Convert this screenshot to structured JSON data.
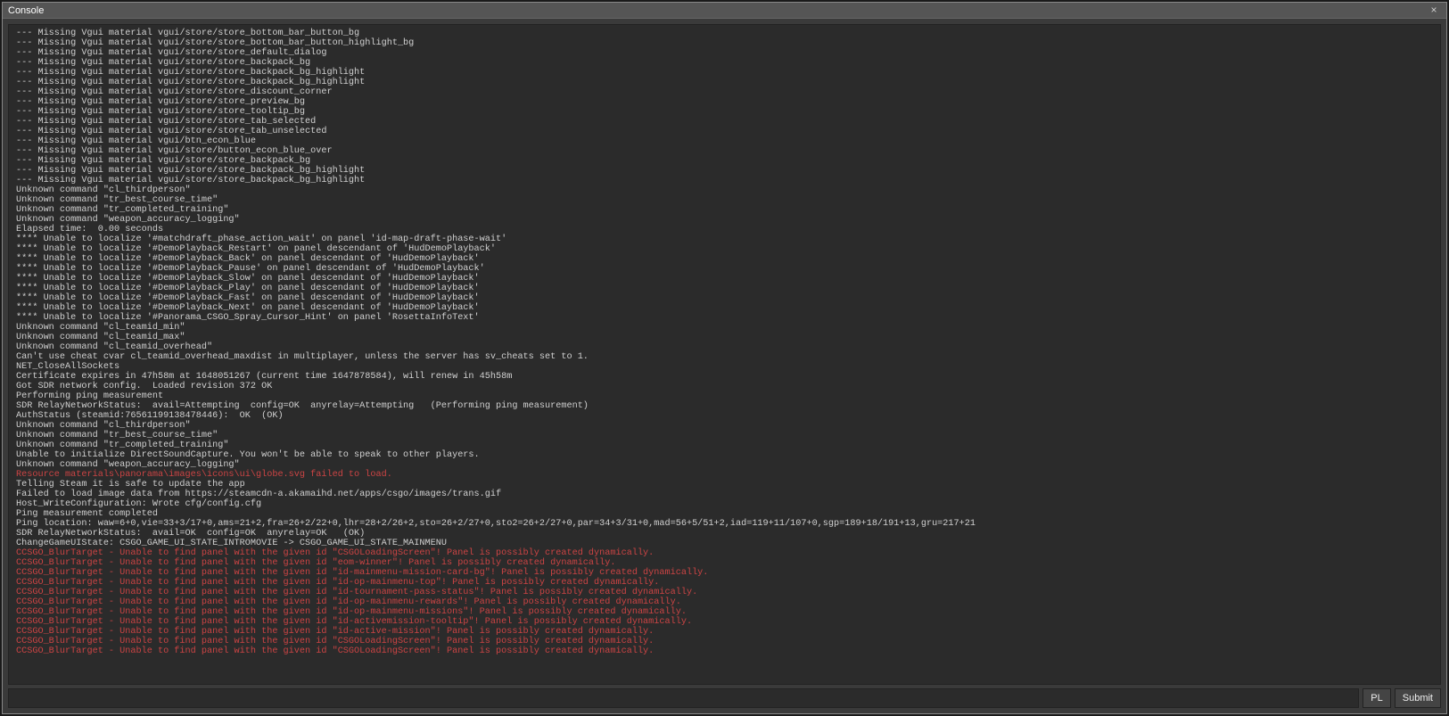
{
  "window": {
    "title": "Console",
    "close_glyph": "×"
  },
  "input": {
    "value": "",
    "placeholder": ""
  },
  "buttons": {
    "lang": "PL",
    "submit": "Submit"
  },
  "log": [
    {
      "t": "--- Missing Vgui material vgui/store/store_bottom_bar_button_bg",
      "c": ""
    },
    {
      "t": "--- Missing Vgui material vgui/store/store_bottom_bar_button_highlight_bg",
      "c": ""
    },
    {
      "t": "--- Missing Vgui material vgui/store/store_default_dialog",
      "c": ""
    },
    {
      "t": "--- Missing Vgui material vgui/store/store_backpack_bg",
      "c": ""
    },
    {
      "t": "--- Missing Vgui material vgui/store/store_backpack_bg_highlight",
      "c": ""
    },
    {
      "t": "--- Missing Vgui material vgui/store/store_backpack_bg_highlight",
      "c": ""
    },
    {
      "t": "--- Missing Vgui material vgui/store/store_discount_corner",
      "c": ""
    },
    {
      "t": "--- Missing Vgui material vgui/store/store_preview_bg",
      "c": ""
    },
    {
      "t": "--- Missing Vgui material vgui/store/store_tooltip_bg",
      "c": ""
    },
    {
      "t": "--- Missing Vgui material vgui/store/store_tab_selected",
      "c": ""
    },
    {
      "t": "--- Missing Vgui material vgui/store/store_tab_unselected",
      "c": ""
    },
    {
      "t": "--- Missing Vgui material vgui/btn_econ_blue",
      "c": ""
    },
    {
      "t": "--- Missing Vgui material vgui/store/button_econ_blue_over",
      "c": ""
    },
    {
      "t": "--- Missing Vgui material vgui/store/store_backpack_bg",
      "c": ""
    },
    {
      "t": "--- Missing Vgui material vgui/store/store_backpack_bg_highlight",
      "c": ""
    },
    {
      "t": "--- Missing Vgui material vgui/store/store_backpack_bg_highlight",
      "c": ""
    },
    {
      "t": "Unknown command \"cl_thirdperson\"",
      "c": ""
    },
    {
      "t": "Unknown command \"tr_best_course_time\"",
      "c": ""
    },
    {
      "t": "Unknown command \"tr_completed_training\"",
      "c": ""
    },
    {
      "t": "Unknown command \"weapon_accuracy_logging\"",
      "c": ""
    },
    {
      "t": "Elapsed time:  0.00 seconds",
      "c": ""
    },
    {
      "t": "**** Unable to localize '#matchdraft_phase_action_wait' on panel 'id-map-draft-phase-wait'",
      "c": ""
    },
    {
      "t": "**** Unable to localize '#DemoPlayback_Restart' on panel descendant of 'HudDemoPlayback'",
      "c": ""
    },
    {
      "t": "**** Unable to localize '#DemoPlayback_Back' on panel descendant of 'HudDemoPlayback'",
      "c": ""
    },
    {
      "t": "**** Unable to localize '#DemoPlayback_Pause' on panel descendant of 'HudDemoPlayback'",
      "c": ""
    },
    {
      "t": "**** Unable to localize '#DemoPlayback_Slow' on panel descendant of 'HudDemoPlayback'",
      "c": ""
    },
    {
      "t": "**** Unable to localize '#DemoPlayback_Play' on panel descendant of 'HudDemoPlayback'",
      "c": ""
    },
    {
      "t": "**** Unable to localize '#DemoPlayback_Fast' on panel descendant of 'HudDemoPlayback'",
      "c": ""
    },
    {
      "t": "**** Unable to localize '#DemoPlayback_Next' on panel descendant of 'HudDemoPlayback'",
      "c": ""
    },
    {
      "t": "**** Unable to localize '#Panorama_CSGO_Spray_Cursor_Hint' on panel 'RosettaInfoText'",
      "c": ""
    },
    {
      "t": "Unknown command \"cl_teamid_min\"",
      "c": ""
    },
    {
      "t": "Unknown command \"cl_teamid_max\"",
      "c": ""
    },
    {
      "t": "Unknown command \"cl_teamid_overhead\"",
      "c": ""
    },
    {
      "t": "Can't use cheat cvar cl_teamid_overhead_maxdist in multiplayer, unless the server has sv_cheats set to 1.",
      "c": ""
    },
    {
      "t": "NET_CloseAllSockets",
      "c": ""
    },
    {
      "t": "Certificate expires in 47h58m at 1648051267 (current time 1647878584), will renew in 45h58m",
      "c": ""
    },
    {
      "t": "Got SDR network config.  Loaded revision 372 OK",
      "c": ""
    },
    {
      "t": "Performing ping measurement",
      "c": ""
    },
    {
      "t": "SDR RelayNetworkStatus:  avail=Attempting  config=OK  anyrelay=Attempting   (Performing ping measurement)",
      "c": ""
    },
    {
      "t": "AuthStatus (steamid:76561199138478446):  OK  (OK)",
      "c": ""
    },
    {
      "t": "Unknown command \"cl_thirdperson\"",
      "c": ""
    },
    {
      "t": "Unknown command \"tr_best_course_time\"",
      "c": ""
    },
    {
      "t": "Unknown command \"tr_completed_training\"",
      "c": ""
    },
    {
      "t": "Unable to initialize DirectSoundCapture. You won't be able to speak to other players.",
      "c": ""
    },
    {
      "t": "Unknown command \"weapon_accuracy_logging\"",
      "c": ""
    },
    {
      "t": "Resource materials\\panorama\\images\\icons\\ui\\globe.svg failed to load.",
      "c": "err"
    },
    {
      "t": "Telling Steam it is safe to update the app",
      "c": ""
    },
    {
      "t": "Failed to load image data from https://steamcdn-a.akamaihd.net/apps/csgo/images/trans.gif",
      "c": ""
    },
    {
      "t": "Host_WriteConfiguration: Wrote cfg/config.cfg",
      "c": ""
    },
    {
      "t": "Ping measurement completed",
      "c": ""
    },
    {
      "t": "Ping location: waw=6+0,vie=33+3/17+0,ams=21+2,fra=26+2/22+0,lhr=28+2/26+2,sto=26+2/27+0,sto2=26+2/27+0,par=34+3/31+0,mad=56+5/51+2,iad=119+11/107+0,sgp=189+18/191+13,gru=217+21",
      "c": ""
    },
    {
      "t": "SDR RelayNetworkStatus:  avail=OK  config=OK  anyrelay=OK   (OK)",
      "c": ""
    },
    {
      "t": "ChangeGameUIState: CSGO_GAME_UI_STATE_INTROMOVIE -> CSGO_GAME_UI_STATE_MAINMENU",
      "c": ""
    },
    {
      "t": "CCSGO_BlurTarget - Unable to find panel with the given id \"CSGOLoadingScreen\"! Panel is possibly created dynamically.",
      "c": "err"
    },
    {
      "t": "CCSGO_BlurTarget - Unable to find panel with the given id \"eom-winner\"! Panel is possibly created dynamically.",
      "c": "err"
    },
    {
      "t": "CCSGO_BlurTarget - Unable to find panel with the given id \"id-mainmenu-mission-card-bg\"! Panel is possibly created dynamically.",
      "c": "err"
    },
    {
      "t": "CCSGO_BlurTarget - Unable to find panel with the given id \"id-op-mainmenu-top\"! Panel is possibly created dynamically.",
      "c": "err"
    },
    {
      "t": "CCSGO_BlurTarget - Unable to find panel with the given id \"id-tournament-pass-status\"! Panel is possibly created dynamically.",
      "c": "err"
    },
    {
      "t": "CCSGO_BlurTarget - Unable to find panel with the given id \"id-op-mainmenu-rewards\"! Panel is possibly created dynamically.",
      "c": "err"
    },
    {
      "t": "CCSGO_BlurTarget - Unable to find panel with the given id \"id-op-mainmenu-missions\"! Panel is possibly created dynamically.",
      "c": "err"
    },
    {
      "t": "CCSGO_BlurTarget - Unable to find panel with the given id \"id-activemission-tooltip\"! Panel is possibly created dynamically.",
      "c": "err"
    },
    {
      "t": "CCSGO_BlurTarget - Unable to find panel with the given id \"id-active-mission\"! Panel is possibly created dynamically.",
      "c": "err"
    },
    {
      "t": "CCSGO_BlurTarget - Unable to find panel with the given id \"CSGOLoadingScreen\"! Panel is possibly created dynamically.",
      "c": "err"
    },
    {
      "t": "CCSGO_BlurTarget - Unable to find panel with the given id \"CSGOLoadingScreen\"! Panel is possibly created dynamically.",
      "c": "err"
    }
  ]
}
